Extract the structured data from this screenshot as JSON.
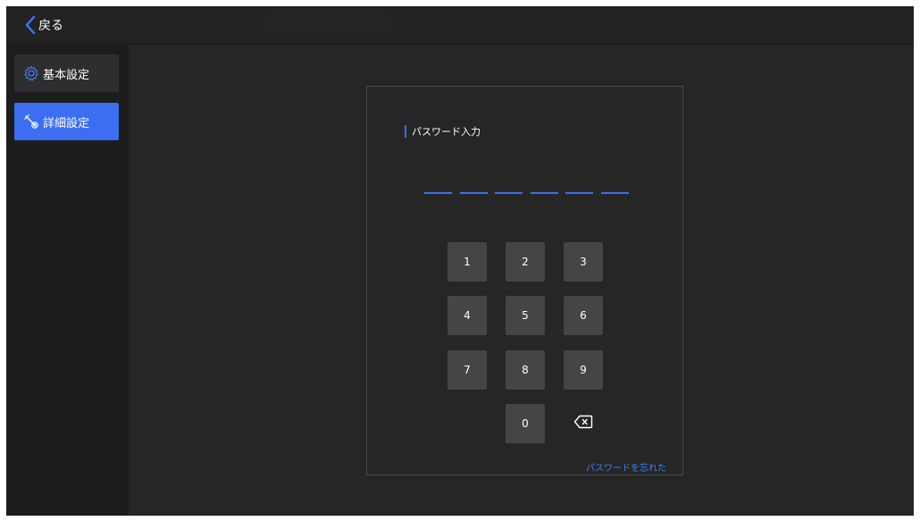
{
  "header": {
    "back_label": "戻る"
  },
  "sidebar": {
    "items": [
      {
        "label": "基本設定",
        "icon": "gear-icon",
        "active": false
      },
      {
        "label": "詳細設定",
        "icon": "wrench-icon",
        "active": true
      }
    ]
  },
  "password_dialog": {
    "title": "パスワード入力",
    "pin_length": 6,
    "keys": [
      "1",
      "2",
      "3",
      "4",
      "5",
      "6",
      "7",
      "8",
      "9",
      "0"
    ],
    "backspace_icon": "backspace-icon",
    "forgot_label": "パスワードを忘れた"
  },
  "colors": {
    "accent": "#3b6ef0",
    "link": "#3b82f6",
    "background": "#262626",
    "key_background": "#454545"
  }
}
